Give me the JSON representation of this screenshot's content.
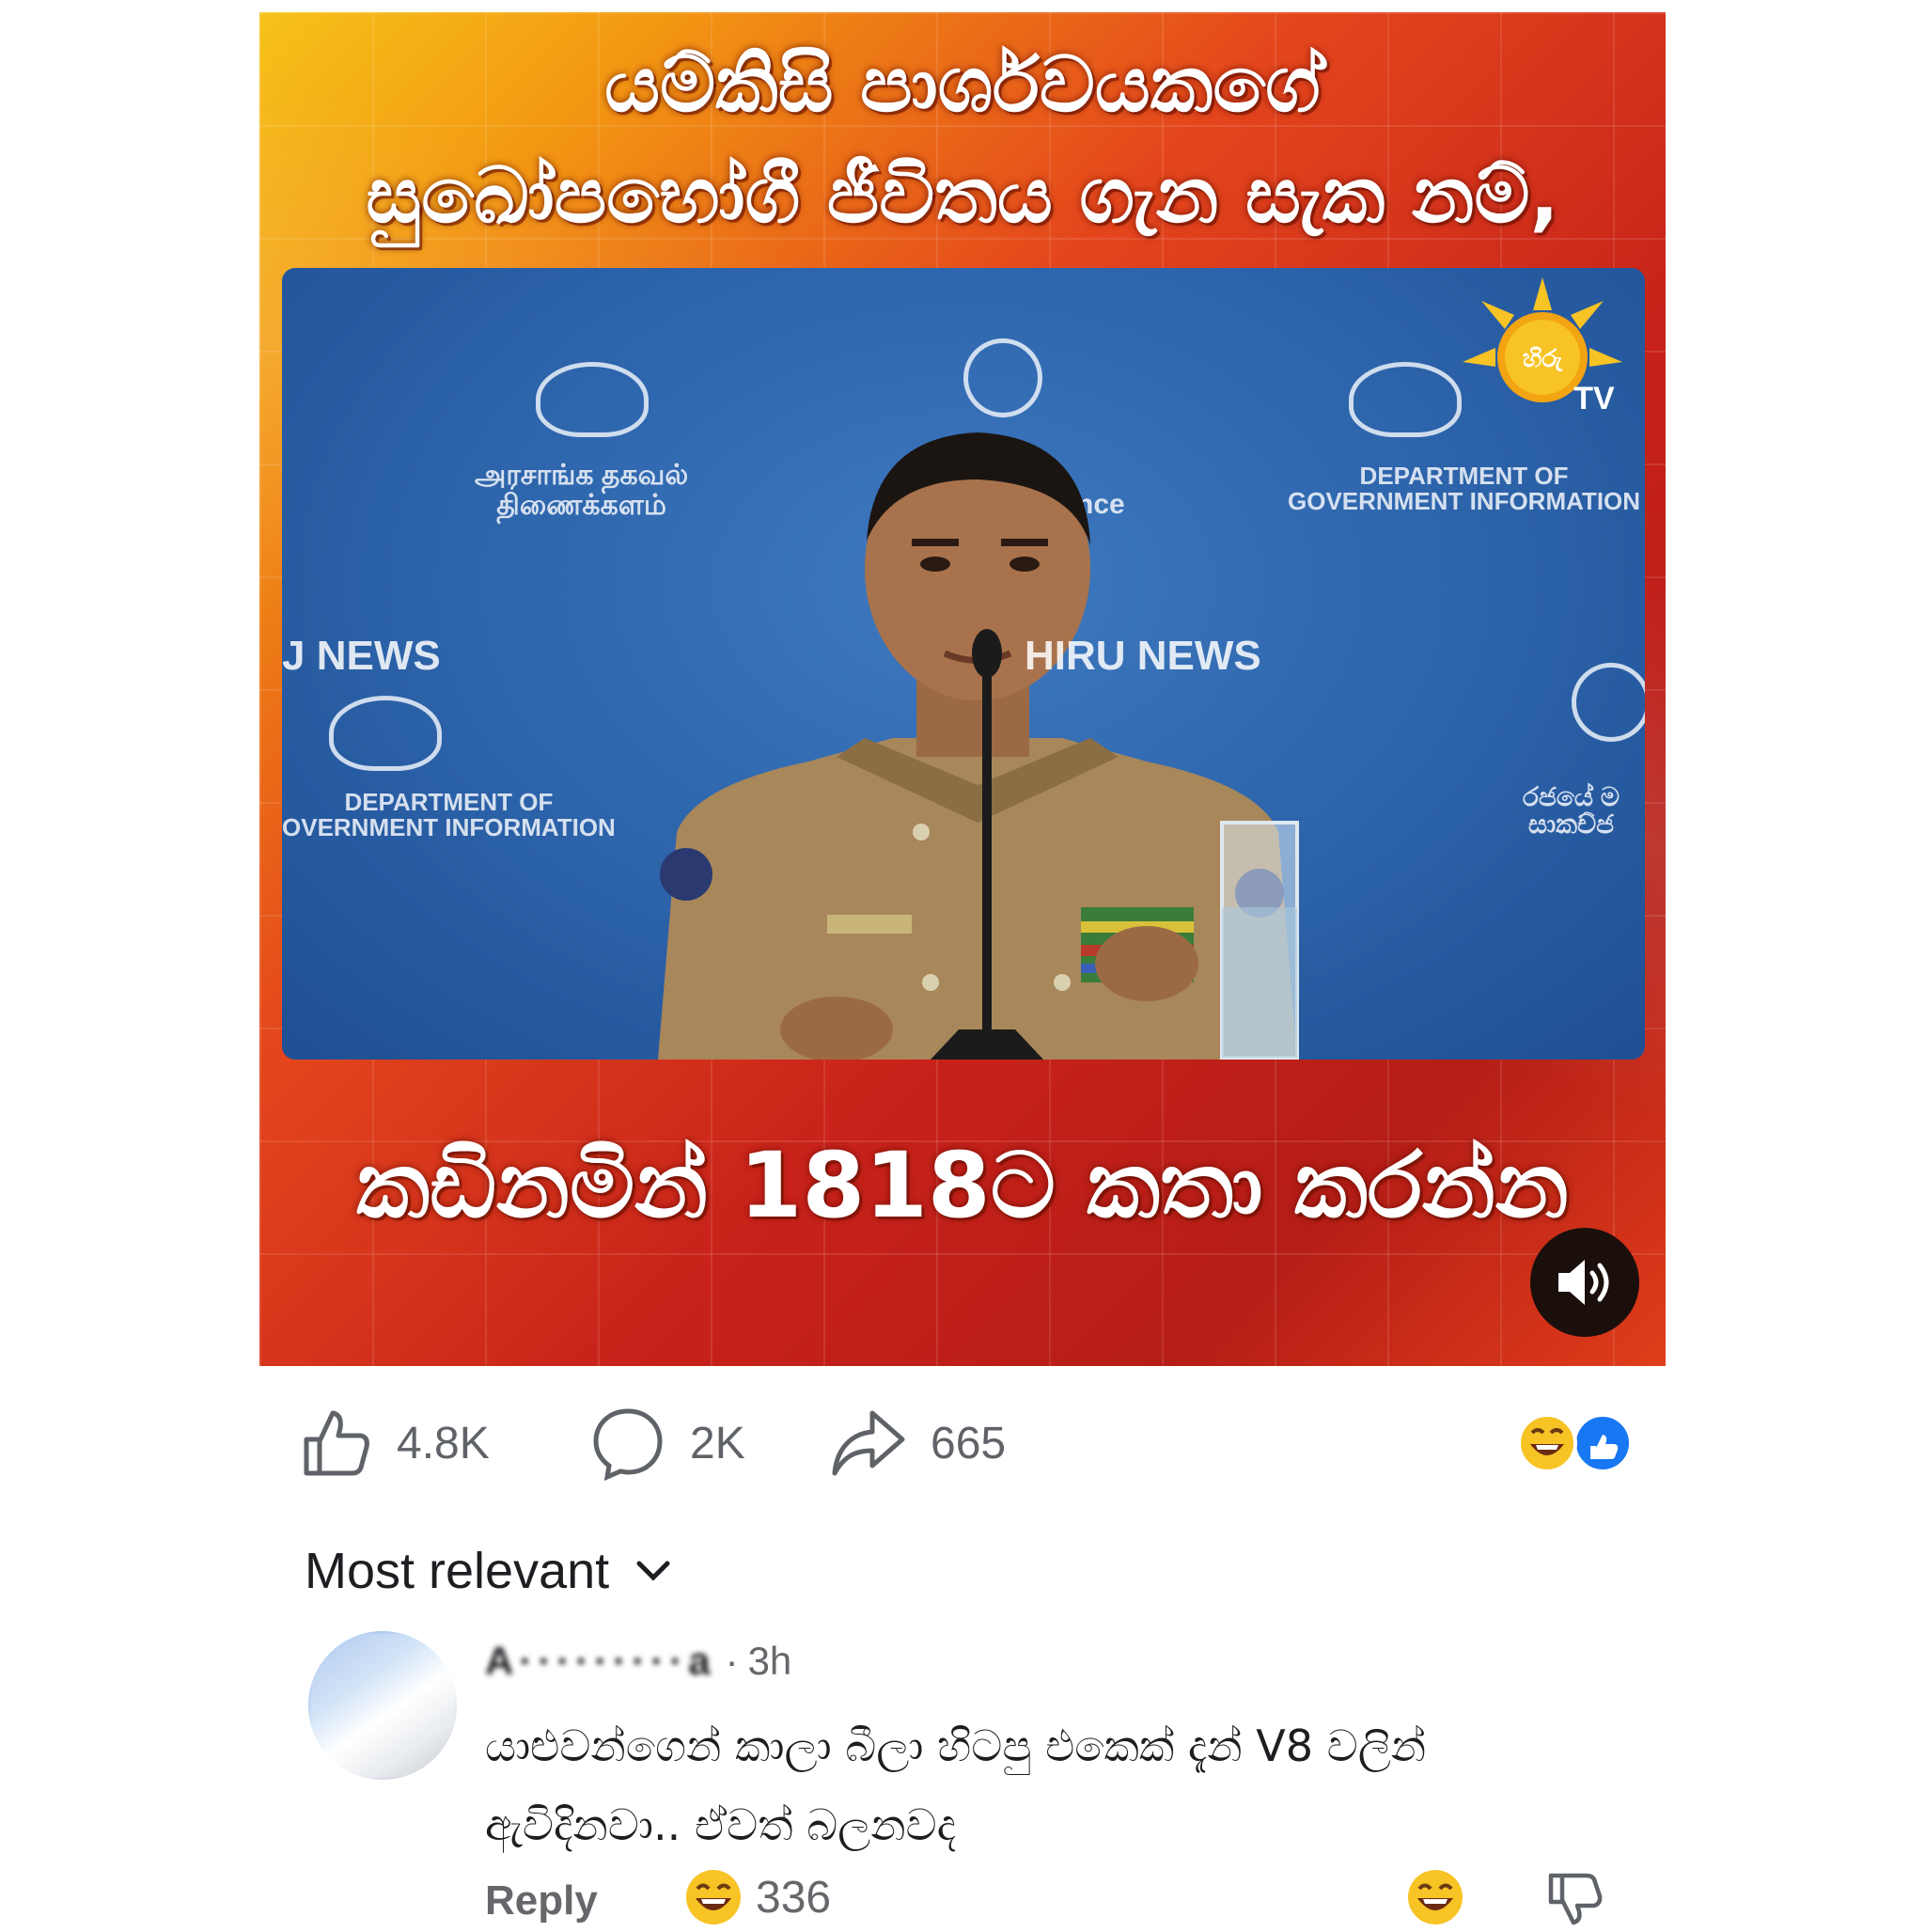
{
  "post": {
    "headline_line1": "යම්කිසි පාර්ශවයකගේ",
    "headline_line2": "සුඛෝපභෝගී ජීවිතය ගැන සැක නම්,",
    "headline_line3": "කඩිනමින් 1818ට කතා කරන්න",
    "video": {
      "backdrop_texts": {
        "tamil_1": "அரசாங்க தகவல்",
        "tamil_2": "திணைக்களம்",
        "dept_1": "DEPARTMENT OF",
        "dept_2": "GOVERNMENT INFORMATION",
        "dept_left_1": "DEPARTMENT OF",
        "dept_left_2": "OVERNMENT INFORMATION",
        "partial_nce": "nce",
        "sinhala_right_1": "රජයේ ම",
        "sinhala_right_2": "සාකච්ජ"
      },
      "watermark_left": "J NEWS",
      "watermark_center": "HIRU NEWS",
      "logo_text": "හිරු",
      "logo_tv": "TV"
    },
    "sound_icon": "speaker-icon"
  },
  "engagement": {
    "likes": "4.8K",
    "comments": "2K",
    "shares": "665",
    "reaction_icons": [
      "laugh-emoji-icon",
      "like-reaction-icon"
    ],
    "colors": {
      "like_blue": "#1877f2",
      "emoji_yellow": "#f7c325"
    }
  },
  "comments": {
    "sort_label": "Most relevant",
    "items": [
      {
        "author": "A·········a",
        "separator": "·",
        "time": "3h",
        "text": "යාළුවන්ගෙන් කාලා බීලා හිටපු එකෙක් දැන් V8 වලින් ඇවිදිනවා.. ඒවත් බලනවද",
        "reply_label": "Reply",
        "reaction_count": "336"
      }
    ]
  }
}
